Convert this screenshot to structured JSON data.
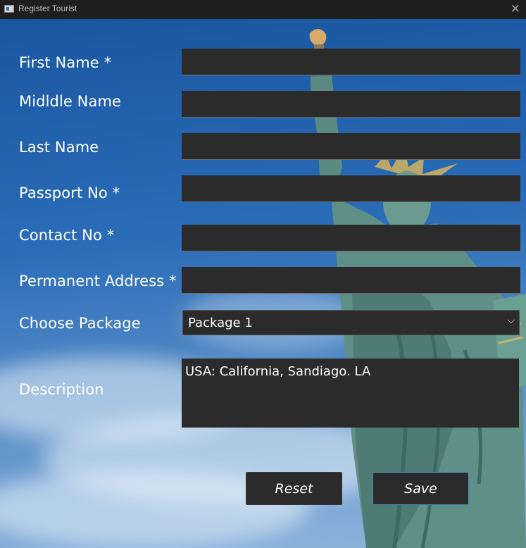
{
  "window": {
    "title": "Register Tourist"
  },
  "form": {
    "first_name_label": "First Name  *",
    "middle_name_label": "Midldle Name",
    "last_name_label": "Last Name",
    "passport_label": "Passport No *",
    "contact_label": "Contact No *",
    "address_label": "Permanent Address *",
    "package_label": "Choose Package",
    "description_label": "Description",
    "first_name_value": "",
    "middle_name_value": "",
    "last_name_value": "",
    "passport_value": "",
    "contact_value": "",
    "address_value": "",
    "package_selected": "Package 1",
    "description_value": "USA: California, Sandiago. LA"
  },
  "buttons": {
    "reset_label": "Reset",
    "save_label": "Save"
  },
  "icons": {
    "close": "close-icon",
    "app": "app-window-icon",
    "dropdown": "chevron-down-icon"
  },
  "colors": {
    "field_bg": "#2b2b2b",
    "save_border": "#4a8fd0",
    "sky": "#1f5fa8"
  }
}
